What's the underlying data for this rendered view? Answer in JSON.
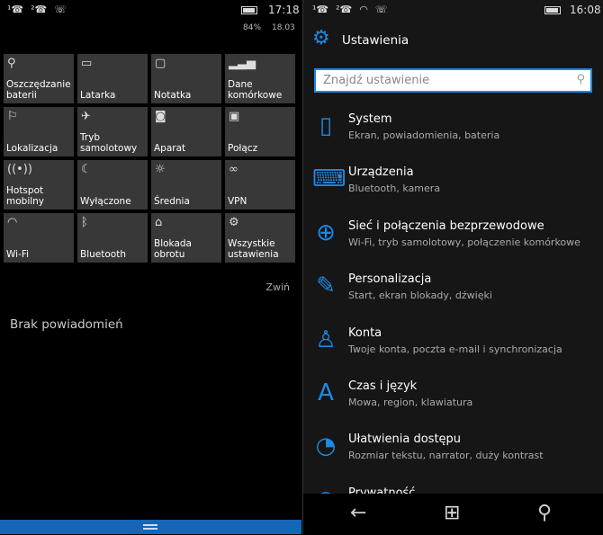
{
  "left": {
    "status": {
      "icons": [
        "missed-call-sim1-icon",
        "missed-call-sim2-icon",
        "voicemail-icon"
      ],
      "time": "17:18",
      "battery": "84%",
      "date": "18.03"
    },
    "tiles": [
      {
        "icon": "leaf-icon",
        "glyph": "⚲",
        "label": "Oszczędzanie\nbaterii"
      },
      {
        "icon": "flashlight-icon",
        "glyph": "▭",
        "label": "Latarka"
      },
      {
        "icon": "note-icon",
        "glyph": "▢",
        "label": "Notatka"
      },
      {
        "icon": "signal-icon",
        "glyph": "▂▃▅",
        "label": "Dane\nkomórkowe"
      },
      {
        "icon": "location-icon",
        "glyph": "⚐",
        "label": "Lokalizacja"
      },
      {
        "icon": "airplane-icon",
        "glyph": "✈",
        "label": "Tryb\nsamolotowy"
      },
      {
        "icon": "camera-icon",
        "glyph": "◙",
        "label": "Aparat"
      },
      {
        "icon": "connect-icon",
        "glyph": "▣",
        "label": "Połącz"
      },
      {
        "icon": "hotspot-icon",
        "glyph": "((•))",
        "label": "Hotspot\nmobilny"
      },
      {
        "icon": "moon-icon",
        "glyph": "☾",
        "label": "Wyłączone"
      },
      {
        "icon": "brightness-icon",
        "glyph": "☼",
        "label": "Średnia"
      },
      {
        "icon": "vpn-icon",
        "glyph": "∞",
        "label": "VPN"
      },
      {
        "icon": "wifi-icon",
        "glyph": "◠",
        "label": "Wi-Fi"
      },
      {
        "icon": "bluetooth-icon",
        "glyph": "ᛒ",
        "label": "Bluetooth"
      },
      {
        "icon": "rotation-lock-icon",
        "glyph": "⌂",
        "label": "Blokada\nobrotu"
      },
      {
        "icon": "gear-icon",
        "glyph": "⚙",
        "label": "Wszystkie\nustawienia"
      }
    ],
    "collapse": "Zwiń",
    "no_notifications": "Brak powiadomień"
  },
  "right": {
    "status": {
      "time": "16:08"
    },
    "title": "Ustawienia",
    "search_placeholder": "Znajdź ustawienie",
    "items": [
      {
        "icon": "phone-icon",
        "glyph": "▯",
        "name": "System",
        "desc": "Ekran, powiadomienia, bateria"
      },
      {
        "icon": "devices-icon",
        "glyph": "⌨",
        "name": "Urządzenia",
        "desc": "Bluetooth, kamera"
      },
      {
        "icon": "globe-icon",
        "glyph": "⊕",
        "name": "Sieć i połączenia bezprzewodowe",
        "desc": "Wi-Fi, tryb samolotowy, połączenie komórkowe"
      },
      {
        "icon": "personalization-icon",
        "glyph": "✎",
        "name": "Personalizacja",
        "desc": "Start, ekran blokady, dźwięki"
      },
      {
        "icon": "person-icon",
        "glyph": "♙",
        "name": "Konta",
        "desc": "Twoje konta, poczta e-mail i synchronizacja"
      },
      {
        "icon": "time-language-icon",
        "glyph": "A",
        "name": "Czas i język",
        "desc": "Mowa, region, klawiatura"
      },
      {
        "icon": "accessibility-icon",
        "glyph": "◔",
        "name": "Ułatwienia dostępu",
        "desc": "Rozmiar tekstu, narrator, duży kontrast"
      },
      {
        "icon": "privacy-icon",
        "glyph": "○",
        "name": "Prywatność",
        "desc": ""
      }
    ],
    "accent": "#1e88e5"
  }
}
